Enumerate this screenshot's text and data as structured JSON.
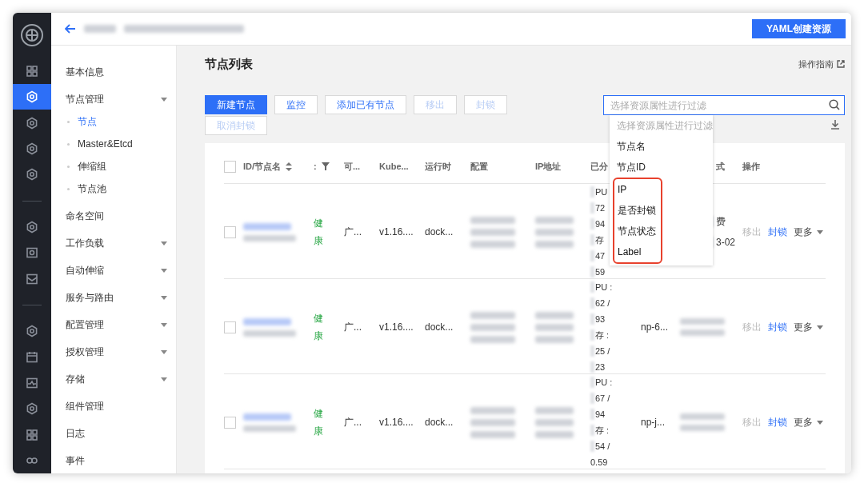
{
  "rail": {
    "groups": [
      {
        "items": [
          {
            "selected": false
          },
          {
            "selected": true
          },
          {
            "selected": false
          },
          {
            "selected": false
          },
          {
            "selected": false
          }
        ]
      },
      {
        "items": [
          {
            "selected": false
          },
          {
            "selected": false
          },
          {
            "selected": false
          }
        ]
      },
      {
        "items": [
          {
            "selected": false
          },
          {
            "selected": false
          },
          {
            "selected": false
          },
          {
            "selected": false
          },
          {
            "selected": false
          },
          {
            "selected": false
          }
        ]
      }
    ]
  },
  "topbar": {
    "action_button": "YAML创建资源"
  },
  "sidebar": {
    "items": [
      {
        "label": "基本信息",
        "has_submenu": false
      },
      {
        "label": "节点管理",
        "has_submenu": true,
        "children": [
          {
            "label": "节点",
            "selected": true
          },
          {
            "label": "Master&Etcd",
            "selected": false
          },
          {
            "label": "伸缩组",
            "selected": false
          },
          {
            "label": "节点池",
            "selected": false
          }
        ]
      },
      {
        "label": "命名空间",
        "has_submenu": false
      },
      {
        "label": "工作负载",
        "has_submenu": true
      },
      {
        "label": "自动伸缩",
        "has_submenu": true
      },
      {
        "label": "服务与路由",
        "has_submenu": true
      },
      {
        "label": "配置管理",
        "has_submenu": true
      },
      {
        "label": "授权管理",
        "has_submenu": true
      },
      {
        "label": "存储",
        "has_submenu": true
      },
      {
        "label": "组件管理",
        "has_submenu": false
      },
      {
        "label": "日志",
        "has_submenu": false
      },
      {
        "label": "事件",
        "has_submenu": false
      }
    ]
  },
  "page": {
    "title": "节点列表",
    "guide_link": "操作指南"
  },
  "toolbar": {
    "buttons": [
      {
        "label": "新建节点",
        "kind": "primary",
        "disabled": false
      },
      {
        "label": "监控",
        "kind": "default",
        "disabled": false
      },
      {
        "label": "添加已有节点",
        "kind": "default",
        "disabled": false
      },
      {
        "label": "移出",
        "kind": "default",
        "disabled": true
      },
      {
        "label": "封锁",
        "kind": "default",
        "disabled": true
      },
      {
        "label": "取消封锁",
        "kind": "default",
        "disabled": true
      }
    ]
  },
  "search": {
    "placeholder": "选择资源属性进行过滤",
    "focused": true,
    "dropdown": [
      {
        "label": "选择资源属性进行过滤",
        "kind": "hint",
        "highlighted": false
      },
      {
        "label": "节点名",
        "kind": "option",
        "highlighted": false
      },
      {
        "label": "节点ID",
        "kind": "option",
        "highlighted": false
      },
      {
        "label": "IP",
        "kind": "option",
        "highlighted": true
      },
      {
        "label": "是否封锁",
        "kind": "option",
        "highlighted": true
      },
      {
        "label": "节点状态",
        "kind": "option",
        "highlighted": true
      },
      {
        "label": "Label",
        "kind": "option",
        "highlighted": true
      }
    ]
  },
  "table": {
    "header_checked": false,
    "columns": [
      {
        "label": "ID/节点名",
        "kind": "sort"
      },
      {
        "label": ":",
        "kind": "filter"
      },
      {
        "label": "可..."
      },
      {
        "label": "Kube..."
      },
      {
        "label": "运行时"
      },
      {
        "label": "配置"
      },
      {
        "label": "IP地址"
      },
      {
        "label": "已分"
      },
      {
        "kind": "covered"
      },
      {
        "label": "式",
        "kind": "cut"
      },
      {
        "label": "操作"
      }
    ],
    "rows": [
      {
        "checked": false,
        "status": "健康",
        "zone": "广...",
        "version": "v1.16....",
        "runtime": "dock...",
        "allocated": [
          {
            "text": "PU",
            "masked": true
          },
          {
            "text": "72",
            "masked": true
          },
          {
            "text": "94",
            "masked": true
          },
          {
            "text": "存",
            "masked": true
          },
          {
            "text": "47",
            "masked": true
          },
          {
            "text": "59",
            "masked": true
          }
        ],
        "billing": [
          "费",
          "3-02"
        ],
        "actions": [
          {
            "label": "移出",
            "kind": "link",
            "disabled": true
          },
          {
            "label": "封锁",
            "kind": "link",
            "disabled": false
          },
          {
            "label": "更多",
            "kind": "menu"
          }
        ]
      },
      {
        "checked": false,
        "status": "健康",
        "zone": "广...",
        "version": "v1.16....",
        "runtime": "dock...",
        "allocated": [
          {
            "text": "PU :",
            "masked": true
          },
          {
            "text": "62 /",
            "masked": true
          },
          {
            "text": "93",
            "masked": true
          },
          {
            "text": "存 :",
            "masked": true
          },
          {
            "text": "25 /",
            "masked": true
          },
          {
            "text": "23",
            "masked": true
          }
        ],
        "node_pool": "np-6...",
        "actions": [
          {
            "label": "移出",
            "kind": "link",
            "disabled": true
          },
          {
            "label": "封锁",
            "kind": "link",
            "disabled": false
          },
          {
            "label": "更多",
            "kind": "menu"
          }
        ]
      },
      {
        "checked": false,
        "status": "健康",
        "zone": "广...",
        "version": "v1.16....",
        "runtime": "dock...",
        "allocated": [
          {
            "text": "PU :",
            "masked": true
          },
          {
            "text": "67 /",
            "masked": true
          },
          {
            "text": "94",
            "masked": true
          },
          {
            "text": "存 :",
            "masked": true
          },
          {
            "text": "54 /",
            "masked": true
          },
          {
            "text": "0.59",
            "masked": false
          }
        ],
        "node_pool": "np-j...",
        "actions": [
          {
            "label": "移出",
            "kind": "link",
            "disabled": true
          },
          {
            "label": "封锁",
            "kind": "link",
            "disabled": false
          },
          {
            "label": "更多",
            "kind": "menu"
          }
        ]
      }
    ]
  }
}
